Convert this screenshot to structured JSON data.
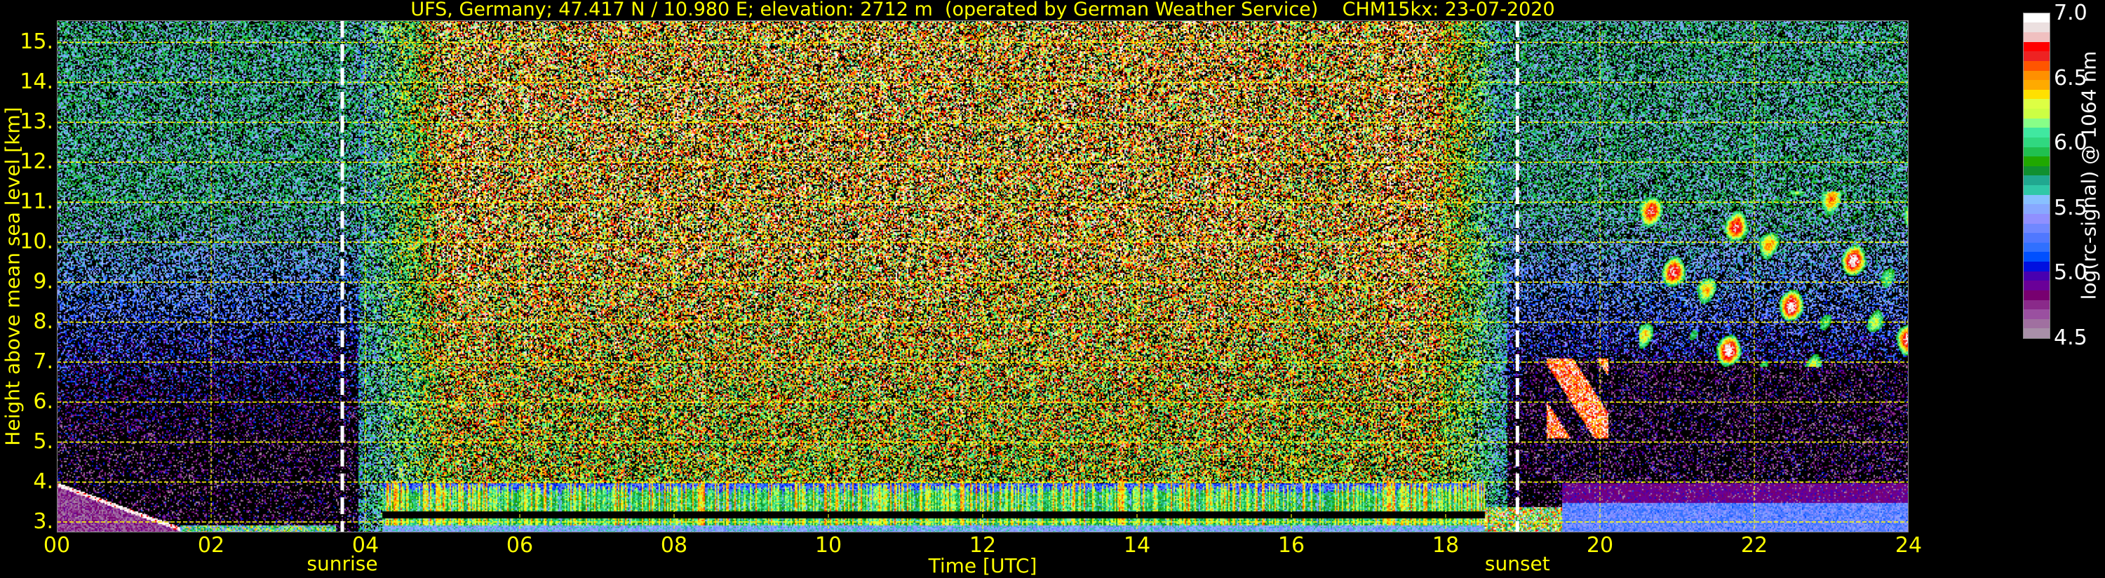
{
  "chart_data": {
    "type": "heatmap",
    "title": "UFS, Germany; 47.417 N / 10.980 E; elevation: 2712 m  (operated by German Weather Service)    CHM15kx: 23-07-2020",
    "xlabel": "Time [UTC]",
    "ylabel": "Height above mean sea level [km]",
    "xlim": [
      0,
      24
    ],
    "ylim": [
      2.74,
      15.55
    ],
    "xticks": [
      0,
      2,
      4,
      6,
      8,
      10,
      12,
      14,
      16,
      18,
      20,
      22,
      24
    ],
    "xtick_labels": [
      "00",
      "02",
      "04",
      "06",
      "08",
      "10",
      "12",
      "14",
      "16",
      "18",
      "20",
      "22",
      "24"
    ],
    "yticks": [
      3,
      4,
      5,
      6,
      7,
      8,
      9,
      10,
      11,
      12,
      13,
      14,
      15
    ],
    "ytick_labels": [
      "3.",
      "4.",
      "5.",
      "6.",
      "7.",
      "8.",
      "9.",
      "10.",
      "11.",
      "12.",
      "13.",
      "14.",
      "15."
    ],
    "grid": true,
    "grid_color": "#ffff00",
    "annotations": [
      {
        "label": "sunrise",
        "time": 3.7
      },
      {
        "label": "sunset",
        "time": 18.93
      }
    ],
    "colorbar": {
      "label": "log(rc-signal) @ 1064 nm",
      "range": [
        4.5,
        7.0
      ],
      "ticks": [
        4.5,
        5.0,
        5.5,
        6.0,
        6.5,
        7.0
      ],
      "tick_labels": [
        "4.5",
        "5.0",
        "5.5",
        "6.0",
        "6.5",
        "7.0"
      ],
      "colors": [
        "#a890a8",
        "#a070a0",
        "#9a50a0",
        "#8a2a8a",
        "#780070",
        "#6a0098",
        "#4800b0",
        "#0010e0",
        "#0050ff",
        "#3070ff",
        "#5078ff",
        "#7088ff",
        "#9090ff",
        "#88a8ff",
        "#88c0ff",
        "#30c8a8",
        "#20a890",
        "#109030",
        "#20a800",
        "#20c050",
        "#30d880",
        "#40e8a0",
        "#88ff88",
        "#ccff44",
        "#ddff44",
        "#ffe000",
        "#ffaa00",
        "#ff9000",
        "#ff5500",
        "#ee2222",
        "#ff0000",
        "#f0c0c0",
        "#ece0e0",
        "#ffffff"
      ]
    },
    "features": [
      {
        "name": "daytime boundary layer aerosol",
        "time": [
          4.2,
          18.5
        ],
        "height_km": [
          2.9,
          4.1
        ],
        "value": 6.2
      },
      {
        "name": "daytime background noise",
        "time": [
          4,
          18.5
        ],
        "height_km": [
          4,
          15.55
        ],
        "value": 6.5
      },
      {
        "name": "night background noise",
        "time": [
          0,
          3.7
        ],
        "height_km": [
          7,
          15.55
        ],
        "value": 5.7
      },
      {
        "name": "early night residual layer",
        "time": [
          0,
          1.5
        ],
        "height_km": [
          2.8,
          4.1
        ],
        "value": 4.7
      },
      {
        "name": "evening cloud",
        "time": [
          19.3,
          20.1
        ],
        "height_km": [
          5.0,
          7.2
        ],
        "value": 6.8
      },
      {
        "name": "cirrus",
        "time": [
          20.5,
          24
        ],
        "height_km": [
          6.8,
          11.3
        ],
        "value": 6.2
      },
      {
        "name": "night boundary layer",
        "time": [
          19.5,
          24
        ],
        "height_km": [
          2.8,
          4.0
        ],
        "value": 5.2
      }
    ]
  }
}
